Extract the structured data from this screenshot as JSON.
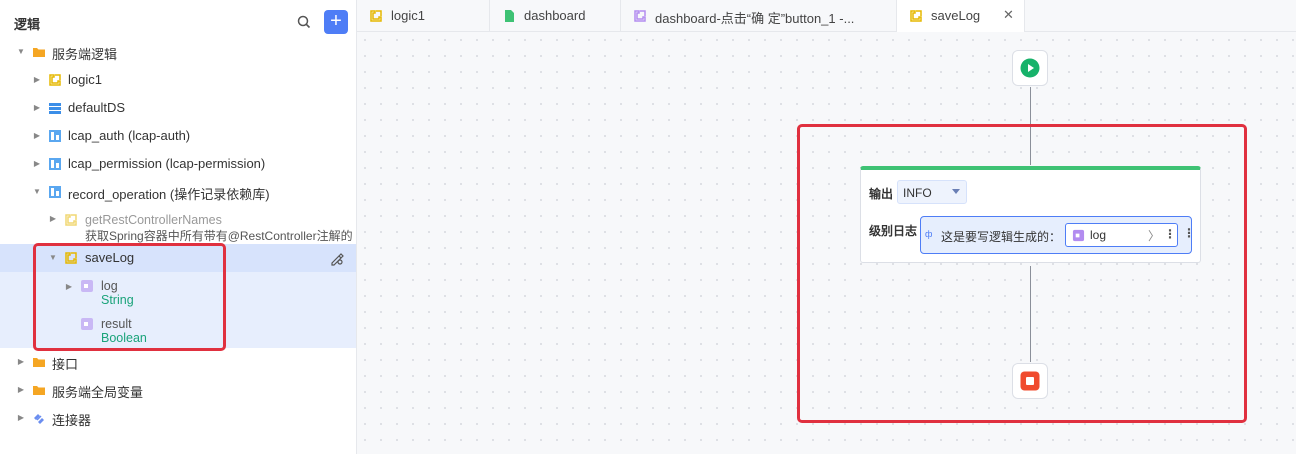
{
  "sidebar": {
    "title": "逻辑",
    "search_icon": "search-icon",
    "add_label": "+",
    "tree": {
      "server_logic": "服务端逻辑",
      "logic1": "logic1",
      "defaultDS": "defaultDS",
      "lcap_auth": "lcap_auth (lcap-auth)",
      "lcap_permission": "lcap_permission (lcap-permission)",
      "record_operation": "record_operation (操作记录依赖库)",
      "getRest_name": "getRestControllerNames",
      "getRest_desc": "获取Spring容器中所有带有@RestController注解的",
      "saveLog": "saveLog",
      "param_log": "log",
      "param_log_type": "String",
      "param_result": "result",
      "param_result_type": "Boolean",
      "interface": "接口",
      "server_globals": "服务端全局变量",
      "connector": "连接器"
    }
  },
  "tabs": [
    {
      "label": "logic1",
      "icon": "logic-icon"
    },
    {
      "label": "dashboard",
      "icon": "page-icon"
    },
    {
      "label": "dashboard-点击“确 定”button_1 -...",
      "icon": "event-logic-icon"
    },
    {
      "label": "saveLog",
      "icon": "logic-icon",
      "active": true,
      "close": "✕"
    }
  ],
  "canvas": {
    "log_node": {
      "output_label": "输出",
      "output_value": "INFO",
      "level_label": "级别日志",
      "string_prefix": "ф",
      "string_text": "这是要写逻辑生成的：",
      "var_name": "log",
      "var_arrow": "〉",
      "menu": "⋮"
    }
  },
  "colors": {
    "accent": "#4e7df6",
    "start_green": "#17b26a",
    "end_red": "#f04b2e",
    "highlight": "#e0303f",
    "type_text": "#1aa37a"
  }
}
